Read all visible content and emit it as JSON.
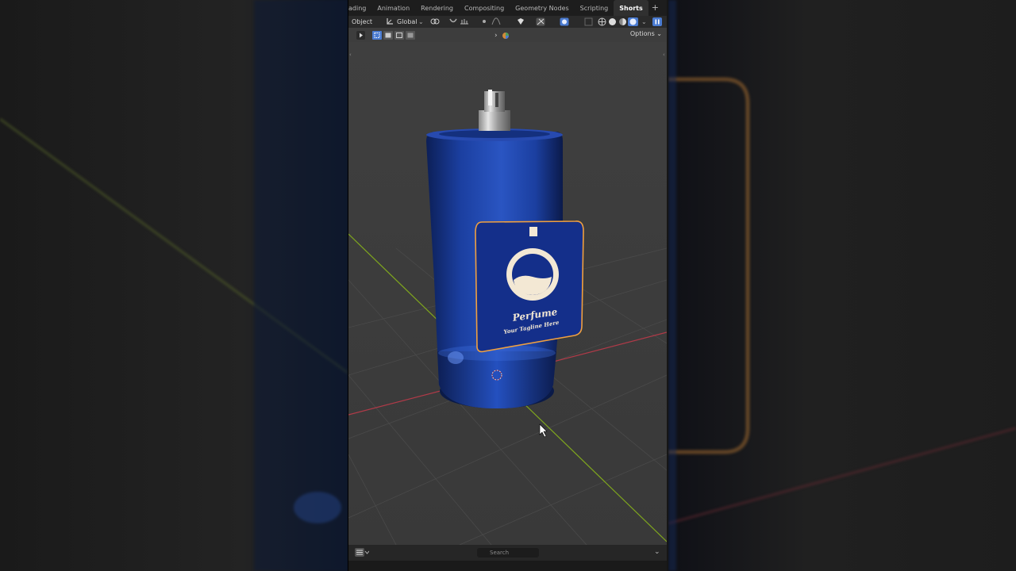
{
  "workspace_tabs": [
    {
      "label": "ading",
      "active": false
    },
    {
      "label": "Animation",
      "active": false
    },
    {
      "label": "Rendering",
      "active": false
    },
    {
      "label": "Compositing",
      "active": false
    },
    {
      "label": "Geometry Nodes",
      "active": false
    },
    {
      "label": "Scripting",
      "active": false
    },
    {
      "label": "Shorts",
      "active": true
    }
  ],
  "add_tab": "+",
  "header": {
    "mode": "Object",
    "transform_orientation": "Global",
    "options": "Options"
  },
  "label": {
    "brand": "Perfume",
    "tagline": "Your Tagline Here"
  },
  "footer": {
    "search_placeholder": "Search"
  },
  "colors": {
    "bottle": "#1b3fa0",
    "label_outline": "#f0a040",
    "label_text": "#f3e8d4",
    "x_axis": "#b03a48",
    "y_axis": "#7ea51e",
    "active_tab": "#303030"
  },
  "icons": [
    "mode-icon",
    "orientation-icon",
    "snap-icon",
    "proportional-icon",
    "visibility-icon",
    "gizmo-icon",
    "overlay-icon",
    "xray-icon",
    "wireframe-shading-icon",
    "solid-shading-icon",
    "material-shading-icon",
    "rendered-shading-icon",
    "pause-icon",
    "select-box-icon",
    "cursor-pointer-icon",
    "editor-type-icon",
    "search-icon"
  ]
}
